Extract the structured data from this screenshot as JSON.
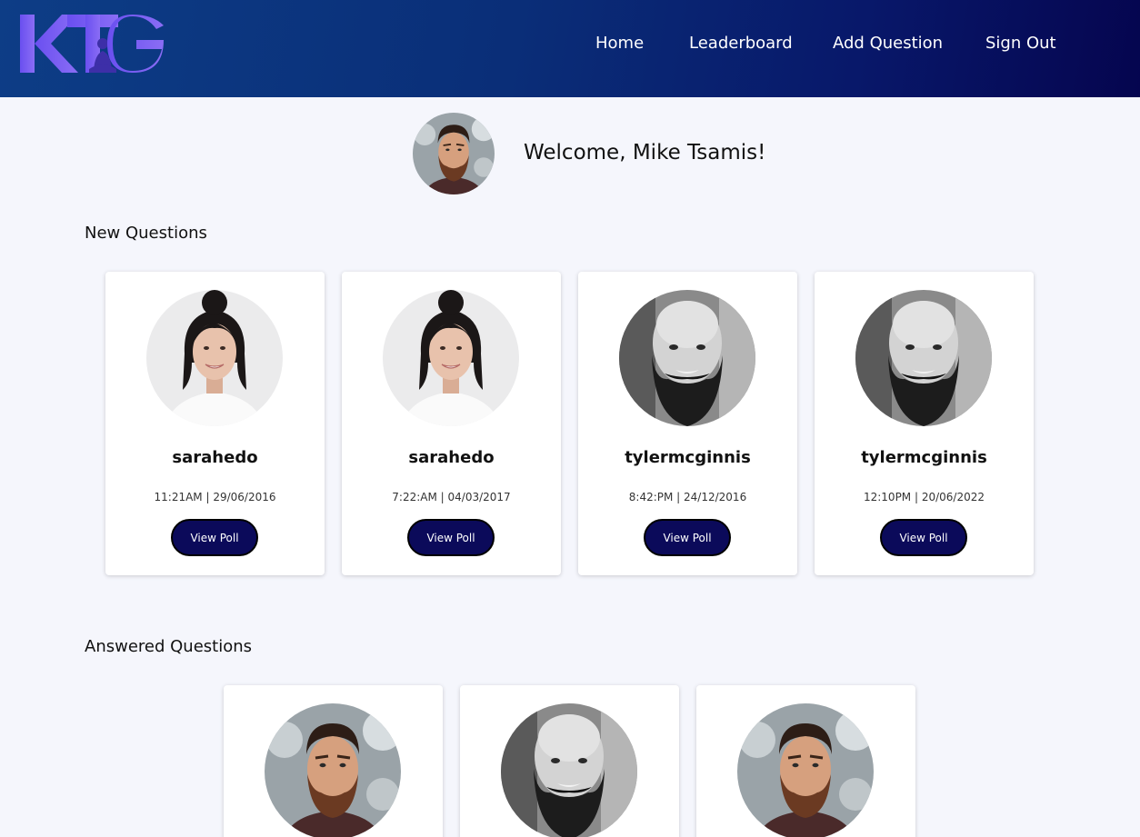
{
  "nav": {
    "logo_text": "KTG",
    "links": [
      "Home",
      "Leaderboard",
      "Add Question",
      "Sign Out"
    ]
  },
  "welcome": {
    "text": "Welcome, Mike Tsamis!"
  },
  "sections": {
    "new_title": "New Questions",
    "answered_title": "Answered Questions"
  },
  "new_questions": [
    {
      "user": "sarahedo",
      "time": "11:21AM | 29/06/2016",
      "button": "View Poll",
      "avatar": "woman-avatar-icon"
    },
    {
      "user": "sarahedo",
      "time": "7:22:AM | 04/03/2017",
      "button": "View Poll",
      "avatar": "woman-avatar-icon"
    },
    {
      "user": "tylermcginnis",
      "time": "8:42:PM | 24/12/2016",
      "button": "View Poll",
      "avatar": "bearded-man-avatar-icon"
    },
    {
      "user": "tylermcginnis",
      "time": "12:10PM | 20/06/2022",
      "button": "View Poll",
      "avatar": "bearded-man-avatar-icon"
    }
  ],
  "answered_questions": [
    {
      "avatar": "man-avatar-icon"
    },
    {
      "avatar": "bearded-man-avatar-icon"
    },
    {
      "avatar": "man-avatar-icon"
    }
  ],
  "colors": {
    "header_start": "#0d3d86",
    "header_end": "#05054f",
    "button_bg": "#0b0a5a",
    "logo_accent": "#7c5cf0"
  }
}
